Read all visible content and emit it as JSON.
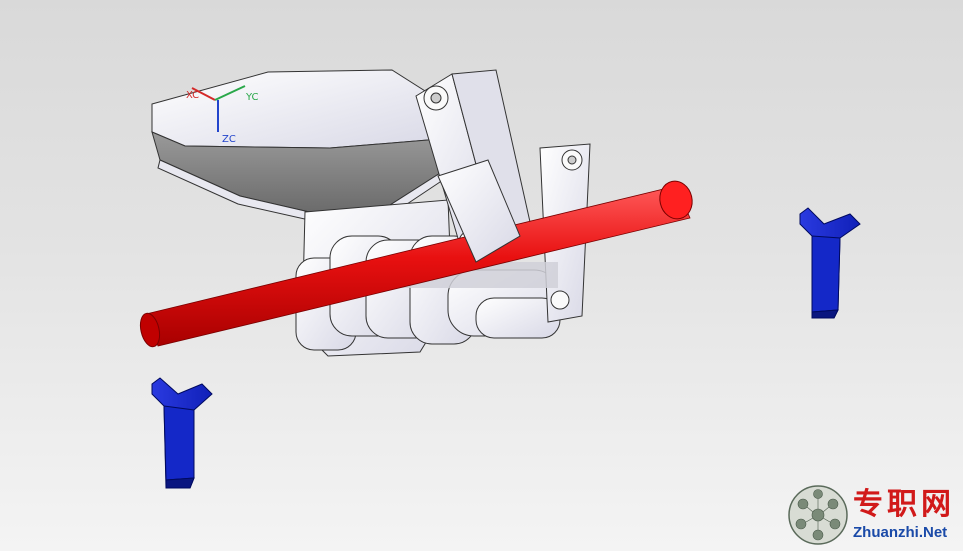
{
  "viewport": {
    "axis_triad": {
      "x_label": "XC",
      "y_label": "YC",
      "z_label": "ZC",
      "x_color": "#d42a2a",
      "y_color": "#2aa84a",
      "z_color": "#2244cc"
    },
    "colors": {
      "rod": "#e81010",
      "v_support": "#1428c8",
      "gripper_body": "#f2f2f8"
    }
  },
  "watermark": {
    "logo_icon": "soccer-ball-icon",
    "text_cn": "专职网",
    "text_en": "Zhuanzhi.Net"
  }
}
